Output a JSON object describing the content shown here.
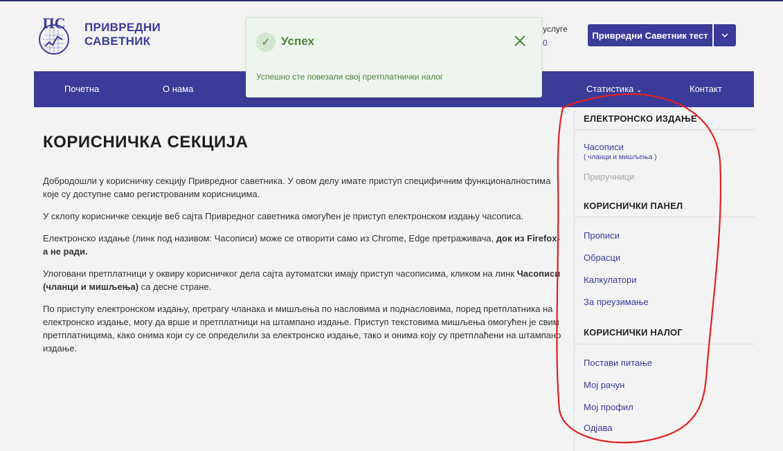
{
  "header": {
    "brand_line1": "ПРИВРЕДНИ",
    "brand_line2": "САВЕТНИК",
    "logo_letters": "ПС",
    "services_line1": "услуге",
    "services_line2": "0",
    "user_button": "Привредни Саветник тест"
  },
  "nav": {
    "items": [
      "Почетна",
      "О нама",
      "Статистика",
      "Контакт"
    ]
  },
  "toast": {
    "title": "Успех",
    "message": "Успешно сте повезали свој претплатнички налог"
  },
  "main": {
    "title": "КОРИСНИЧКА СЕКЦИЈА",
    "p1": "Добродошли у корисничку секцију Привредног саветника. У овом делу имате приступ специфичним функционалностима које су доступне само регистрованим корисницима.",
    "p2": "У склопу корисничке секције веб сајта Привредног саветника омогућен је приступ електронском издању часописа.",
    "p3_text": "Електронско издање (линк под називом: Часописи) може се отворити само из Chrome, Edge претраживача, ",
    "p3_bold": "док из Firefox-а не ради.",
    "p4_text": "Улоговани претплатници у оквиру корисничког дела сајта аутоматски имају приступ часописима, кликом на линк ",
    "p4_bold": "Часописи (чланци и мишљења)",
    "p4_tail": " са десне стране.",
    "p5": "По приступу електронском издању, претрагу чланака и мишљења по насловима и поднасловима, поред претплатника на електронско издање, могу да врше и претплатници на штампано издање. Приступ текстовима мишљења омогућен је свим претплатницима, како онима који су се определили за електронско издање, тако и онима коју су претплаћени на штампано издање."
  },
  "sidebar": {
    "section1": "ЕЛЕКТРОНСКО ИЗДАЊЕ",
    "link_casopisi": "Часописи",
    "link_casopisi_sub": "( чланци и мишљења )",
    "link_prirucnici": "Приручници",
    "section2": "КОРИСНИЧКИ ПАНЕЛ",
    "panel": [
      "Прописи",
      "Обрасци",
      "Калкулатори",
      "За преузимање"
    ],
    "section3": "КОРИСНИЧКИ НАЛОГ",
    "account": [
      "Постави питање",
      "Мој рачун",
      "Мој профил",
      "Одјава"
    ]
  },
  "colors": {
    "brand": "#3b3b99",
    "success_text": "#4d7e3e",
    "annotation": "#e02020"
  },
  "icons": [
    "logo-icon",
    "chevron-down-icon",
    "check-icon",
    "close-icon"
  ]
}
